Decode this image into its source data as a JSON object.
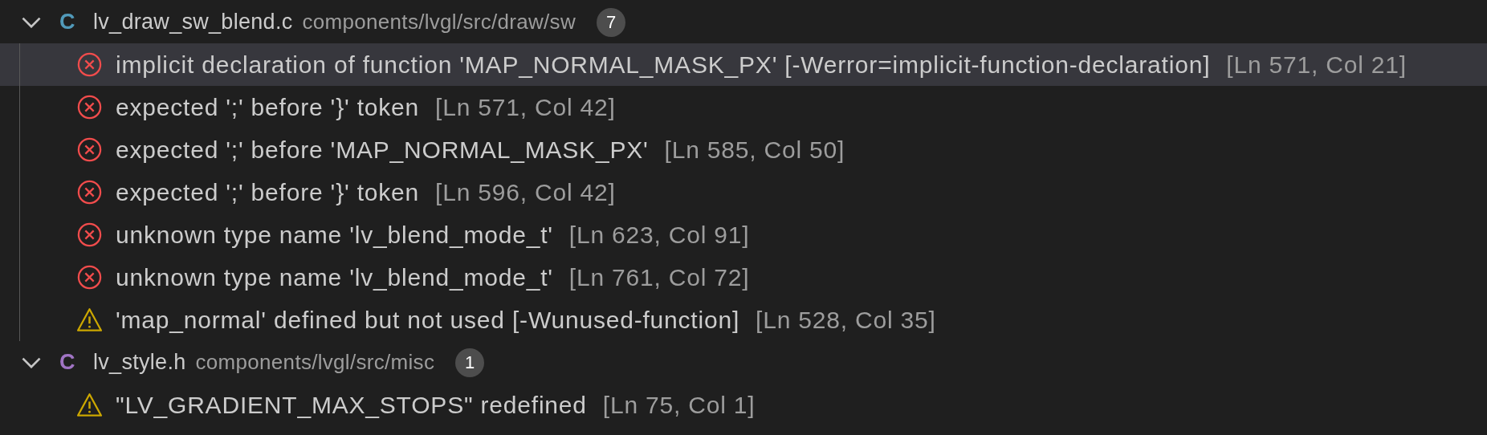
{
  "files": [
    {
      "icon": "C",
      "color": "#519aba",
      "name": "lv_draw_sw_blend.c",
      "path": "components/lvgl/src/draw/sw",
      "count": "7",
      "expanded": true,
      "problems": [
        {
          "kind": "error",
          "message": "implicit declaration of function 'MAP_NORMAL_MASK_PX' [-Werror=implicit-function-declaration]",
          "location": "[Ln 571, Col 21]",
          "selected": true
        },
        {
          "kind": "error",
          "message": "expected ';' before '}' token",
          "location": "[Ln 571, Col 42]",
          "selected": false
        },
        {
          "kind": "error",
          "message": "expected ';' before 'MAP_NORMAL_MASK_PX'",
          "location": "[Ln 585, Col 50]",
          "selected": false
        },
        {
          "kind": "error",
          "message": "expected ';' before '}' token",
          "location": "[Ln 596, Col 42]",
          "selected": false
        },
        {
          "kind": "error",
          "message": "unknown type name 'lv_blend_mode_t'",
          "location": "[Ln 623, Col 91]",
          "selected": false
        },
        {
          "kind": "error",
          "message": "unknown type name 'lv_blend_mode_t'",
          "location": "[Ln 761, Col 72]",
          "selected": false
        },
        {
          "kind": "warning",
          "message": "'map_normal' defined but not used [-Wunused-function]",
          "location": "[Ln 528, Col 35]",
          "selected": false
        }
      ]
    },
    {
      "icon": "C",
      "color": "#a074c4",
      "name": "lv_style.h",
      "path": "components/lvgl/src/misc",
      "count": "1",
      "expanded": true,
      "problems": [
        {
          "kind": "warning",
          "message": "\"LV_GRADIENT_MAX_STOPS\" redefined",
          "location": "[Ln 75, Col 1]",
          "selected": false
        }
      ]
    }
  ]
}
